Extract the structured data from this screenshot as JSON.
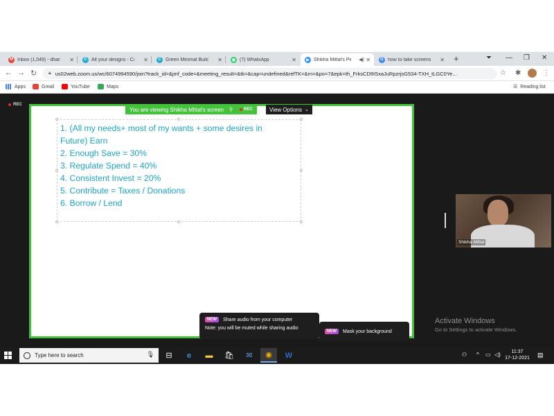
{
  "browser": {
    "tabs": [
      {
        "title": "Inbox (1,049) - dhana",
        "favicon": "gmail-icon",
        "active": false
      },
      {
        "title": "All your designs - Can",
        "favicon": "canva-icon",
        "active": false
      },
      {
        "title": "Green Minimal Buildi",
        "favicon": "canva-icon",
        "active": false
      },
      {
        "title": "(7) WhatsApp",
        "favicon": "whatsapp-icon",
        "active": false
      },
      {
        "title": "Shikha Mittal's Pe",
        "favicon": "zoom-icon",
        "active": true
      },
      {
        "title": "how to take screensho",
        "favicon": "google-icon",
        "active": false
      }
    ],
    "url": "us02web.zoom.us/wc/6074994590/join?track_id=&jmf_code=&meeting_result=&tk=&cap=undefined&refTK=&rn=&po=7&epk=th_FrksCD9ISxaJuRpzrjsG534-TXH_tLGC0Ye...",
    "bookmarks": [
      {
        "label": "Apps",
        "icon": "apps-grid-icon",
        "color": "#4285f4"
      },
      {
        "label": "Gmail",
        "icon": "gmail-icon",
        "color": "#ea4335"
      },
      {
        "label": "YouTube",
        "icon": "youtube-icon",
        "color": "#ff0000"
      },
      {
        "label": "Maps",
        "icon": "maps-icon",
        "color": "#34a853"
      }
    ],
    "reading_list": "Reading list"
  },
  "meeting": {
    "rec_label": "REC",
    "share_banner": "You are viewing Shikha Mittal's screen",
    "banner_rec": "REC",
    "view_options": "View Options",
    "slide_lines": [
      "1. (All my needs+ most of my wants + some desires in",
      "Future) Earn",
      "2. Enough Save = 30%",
      "3. Regulate Spend = 40%",
      "4. Consistent Invest = 20%",
      "5. Contribute = Taxes / Donations",
      "6. Borrow / Lend"
    ],
    "participant_name": "Shikha Mittal",
    "activate_title": "Activate Windows",
    "activate_sub": "Go to Settings to activate Windows.",
    "tooltip_audio": {
      "badge": "NEW",
      "title": "Share audio from your computer",
      "note": "Note: you will be muted while sharing audio"
    },
    "tooltip_background": {
      "badge": "NEW",
      "title": "Mask your background"
    },
    "accent_green": "#45c23c",
    "slide_text_color": "#1aa5c8"
  },
  "taskbar": {
    "search_placeholder": "Type here to search",
    "time": "11:37",
    "date": "17-12-2021",
    "apps": [
      "task-view-icon",
      "edge-icon",
      "file-explorer-icon",
      "store-icon",
      "mail-icon",
      "chrome-icon",
      "word-icon"
    ]
  }
}
